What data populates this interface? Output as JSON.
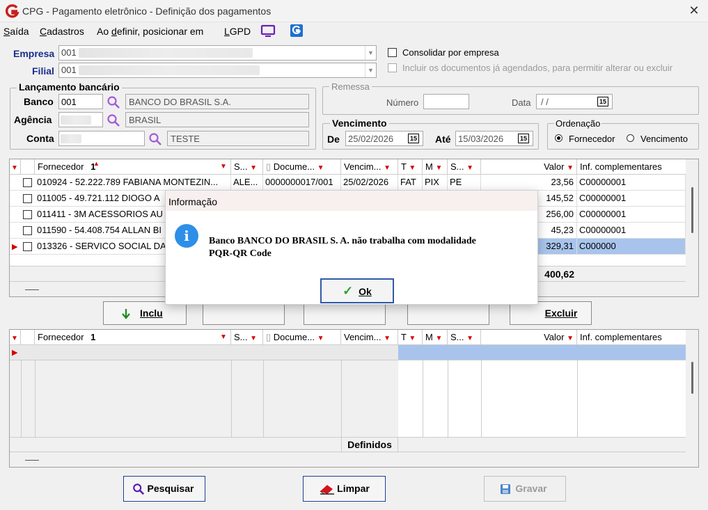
{
  "window": {
    "title": "CPG - Pagamento eletrônico - Definição dos pagamentos"
  },
  "menu": {
    "items": [
      "Saída",
      "Cadastros",
      "Ao definir, posicionar em",
      "LGPD"
    ]
  },
  "empresa": {
    "label": "Empresa",
    "value": "001"
  },
  "filial": {
    "label": "Filial",
    "value": "001"
  },
  "options": {
    "consolidar": "Consolidar por empresa",
    "incluir_agendados": "Incluir os documentos já agendados, para permitir alterar ou excluir"
  },
  "lancamento": {
    "title": "Lançamento bancário",
    "banco_label": "Banco",
    "banco_code": "001",
    "banco_name": "BANCO DO BRASIL S.A.",
    "agencia_label": "Agência",
    "agencia_name": "BRASIL",
    "conta_label": "Conta",
    "conta_name": "TESTE"
  },
  "remessa": {
    "title": "Remessa",
    "numero_label": "Número",
    "data_label": "Data",
    "data_value": "/ /"
  },
  "vencimento": {
    "title": "Vencimento",
    "de_label": "De",
    "de_value": "25/02/2026",
    "ate_label": "Até",
    "ate_value": "15/03/2026",
    "cal": "15"
  },
  "ordenacao": {
    "title": "Ordenação",
    "fornecedor": "Fornecedor",
    "vencimento": "Vencimento"
  },
  "grid_top": {
    "headers": [
      "Fornecedor",
      "S...",
      "Docume...",
      "Vencim...",
      "T",
      "M",
      "S...",
      "Valor",
      "Inf. complementares"
    ],
    "rows": [
      {
        "fornecedor": "010924 - 52.222.789 FABIANA MONTEZIN...",
        "s": "ALE...",
        "doc": "0000000017/001",
        "venc": "25/02/2026",
        "t": "FAT",
        "m": "PIX",
        "s2": "PE",
        "valor": "23,56",
        "inf": "C00000001"
      },
      {
        "fornecedor": "011005 - 49.721.112 DIOGO A",
        "valor": "145,52",
        "inf": "C00000001"
      },
      {
        "fornecedor": "011411 - 3M ACESSORIOS AU",
        "valor": "256,00",
        "inf": "C00000001"
      },
      {
        "fornecedor": "011590 - 54.408.754 ALLAN BI",
        "valor": "45,23",
        "inf": "C00000001"
      },
      {
        "fornecedor": "013326 - SERVICO SOCIAL DA",
        "valor": "329,31",
        "inf": "C000000"
      }
    ],
    "total": "400,62"
  },
  "mid_buttons": {
    "incluir": "Inclu",
    "excluir": "Excluir"
  },
  "grid_bottom": {
    "headers": [
      "Fornecedor",
      "S...",
      "Docume...",
      "Vencim...",
      "T",
      "M",
      "S...",
      "Valor",
      "Inf. complementares"
    ],
    "footer": "Definidos"
  },
  "bottom_buttons": {
    "pesquisar": "Pesquisar",
    "limpar": "Limpar",
    "gravar": "Gravar"
  },
  "dialog": {
    "title": "Informação",
    "message_line1": "Banco BANCO DO BRASIL S. A. não trabalha com modalidade",
    "message_line2": "PQR-QR Code",
    "ok": "Ok"
  },
  "colors": {
    "accent": "#2d8fe8",
    "selected_row": "#a8c4ec",
    "label_blue": "#1a2e8c",
    "filter_red": "#d40000"
  }
}
